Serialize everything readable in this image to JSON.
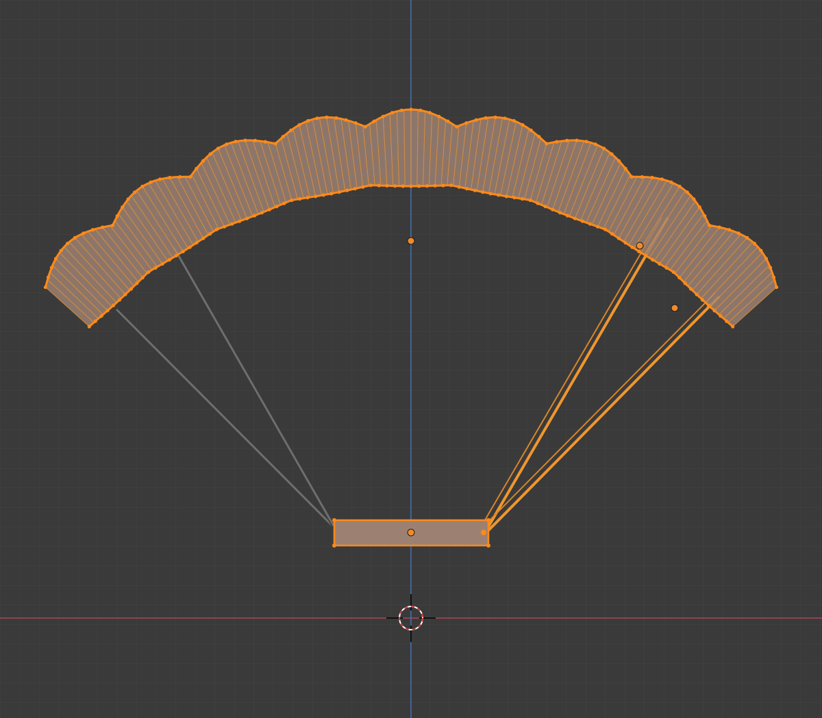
{
  "viewport": {
    "view": "3D Viewport",
    "background": "#3a3a3a"
  },
  "colors": {
    "grid_minor": "#444444",
    "grid_major": "#4d4d4d",
    "axis_x": "#a84b55",
    "axis_z": "#3f73b3",
    "selected": "#ff8a1a",
    "selected_line": "#f0962e",
    "selected_fill": "#9c8172",
    "unselected_line": "#6a6a6a",
    "origin_dot": "#f28a2a"
  },
  "scene": {
    "objects": [
      {
        "name": "canopy",
        "type": "mesh",
        "selected": true
      },
      {
        "name": "harness-bar",
        "type": "mesh",
        "selected": true
      },
      {
        "name": "left-lines",
        "type": "mesh",
        "selected": false
      },
      {
        "name": "right-lines",
        "type": "mesh",
        "selected": true
      }
    ],
    "cursor": "3d-cursor-icon"
  }
}
